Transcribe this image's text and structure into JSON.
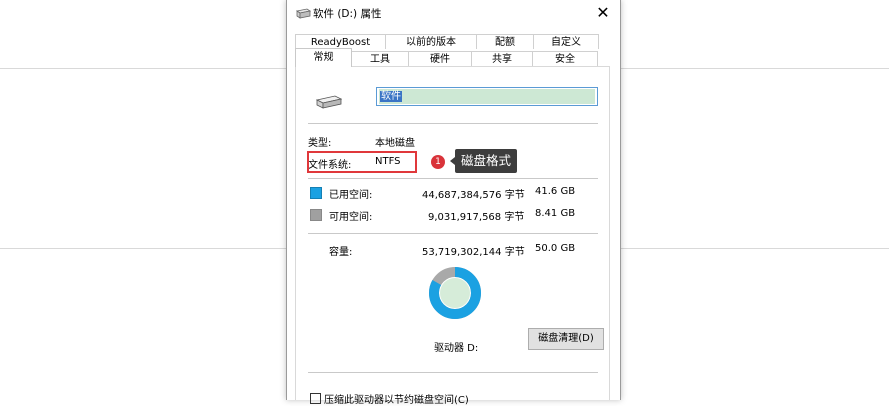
{
  "window": {
    "title": "软件 (D:) 属性",
    "close_glyph": "✕"
  },
  "tabs_back": [
    "ReadyBoost",
    "以前的版本",
    "配额",
    "自定义"
  ],
  "tabs_front": [
    "常规",
    "工具",
    "硬件",
    "共享",
    "安全"
  ],
  "active_tab": "常规",
  "drive_name": "软件",
  "type": {
    "label": "类型:",
    "value": "本地磁盘"
  },
  "filesystem": {
    "label": "文件系统:",
    "value": "NTFS"
  },
  "annotation": {
    "number": "1",
    "text": "磁盘格式"
  },
  "used": {
    "label": "已用空间:",
    "bytes": "44,687,384,576 字节",
    "size": "41.6 GB",
    "color": "#1ba1e2"
  },
  "free": {
    "label": "可用空间:",
    "bytes": "9,031,917,568 字节",
    "size": "8.41 GB",
    "color": "#a0a0a0"
  },
  "capacity": {
    "label": "容量:",
    "bytes": "53,719,302,144 字节",
    "size": "50.0 GB"
  },
  "usage_fraction": 0.832,
  "drive_label": "驱动器 D:",
  "cleanup_button": "磁盘清理(D)",
  "compress_checkbox": "压缩此驱动器以节约磁盘空间(C)"
}
